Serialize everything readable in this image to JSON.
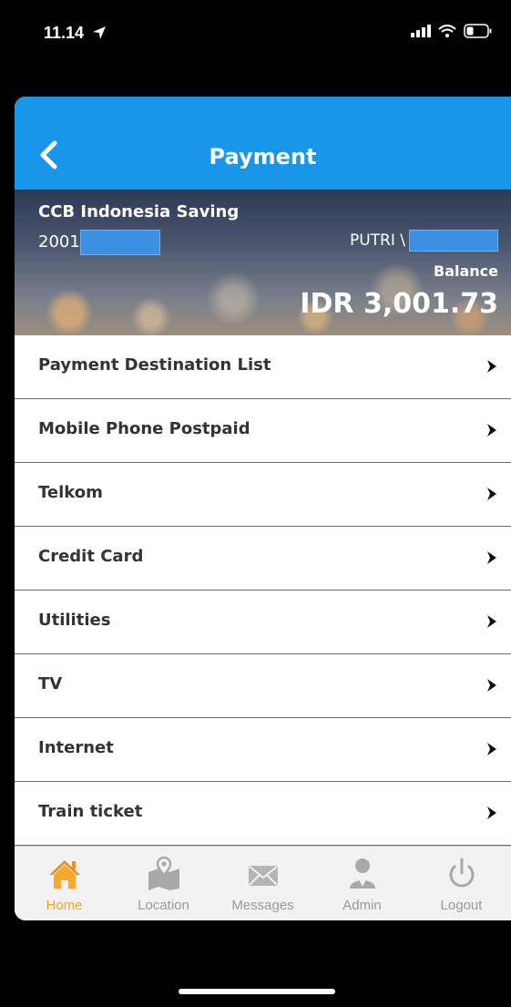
{
  "status_bar": {
    "time": "11.14"
  },
  "header": {
    "title": "Payment"
  },
  "account": {
    "name": "CCB Indonesia Saving",
    "number_prefix": "2001",
    "holder_prefix": "PUTRI \\",
    "balance_label": "Balance",
    "balance_value": "IDR 3,001.73"
  },
  "menu": {
    "items": [
      {
        "label": "Payment Destination List"
      },
      {
        "label": "Mobile Phone Postpaid"
      },
      {
        "label": "Telkom"
      },
      {
        "label": "Credit Card"
      },
      {
        "label": "Utilities"
      },
      {
        "label": "TV"
      },
      {
        "label": "Internet"
      },
      {
        "label": "Train ticket"
      }
    ]
  },
  "tabbar": {
    "tabs": [
      {
        "label": "Home",
        "icon": "home-icon",
        "active": true
      },
      {
        "label": "Location",
        "icon": "map-pin-icon",
        "active": false
      },
      {
        "label": "Messages",
        "icon": "envelope-icon",
        "active": false
      },
      {
        "label": "Admin",
        "icon": "person-icon",
        "active": false
      },
      {
        "label": "Logout",
        "icon": "power-icon",
        "active": false
      }
    ]
  },
  "colors": {
    "header_blue": "#1996ea",
    "active_tab": "#f5a623",
    "inactive_tab": "#9a9a9a",
    "mask_blue": "#3d8fe2"
  }
}
